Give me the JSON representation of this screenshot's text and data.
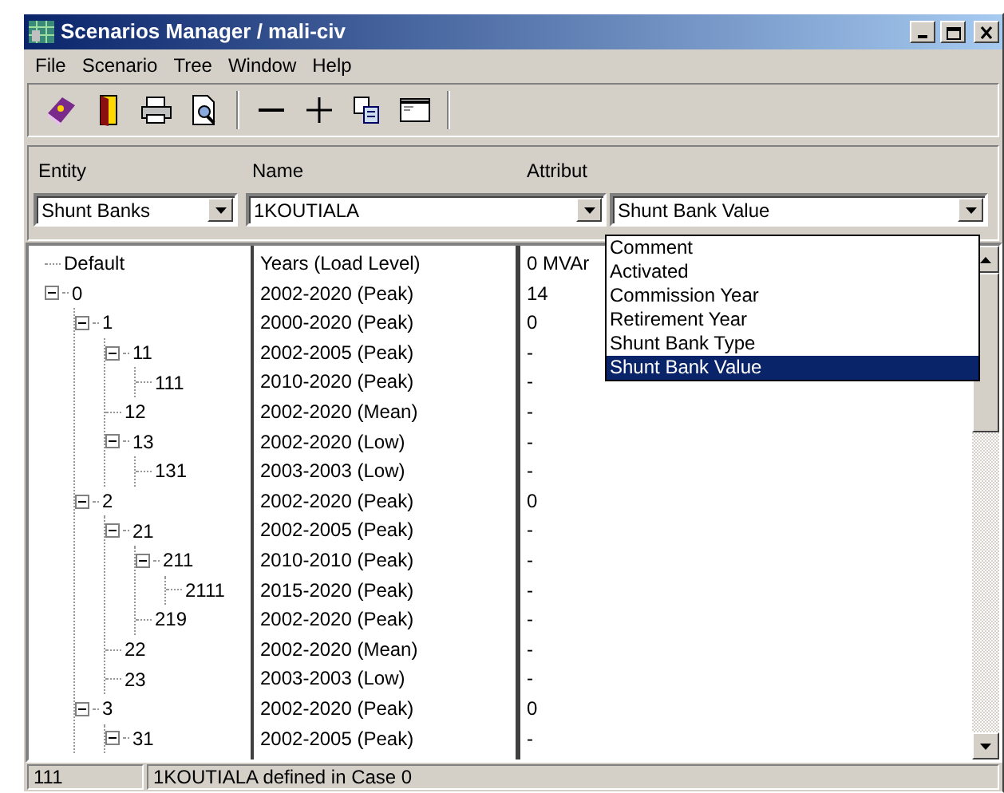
{
  "window": {
    "title": "Scenarios Manager / mali-civ"
  },
  "menu": [
    "File",
    "Scenario",
    "Tree",
    "Window",
    "Help"
  ],
  "filters": {
    "entity": {
      "label": "Entity",
      "value": "Shunt Banks"
    },
    "name": {
      "label": "Name",
      "value": "1KOUTIALA"
    },
    "attribute": {
      "label": "Attribut",
      "value": "Shunt Bank Value",
      "options": [
        {
          "label": "Comment",
          "selected": false
        },
        {
          "label": "Activated",
          "selected": false
        },
        {
          "label": "Commission Year",
          "selected": false
        },
        {
          "label": "Retirement Year",
          "selected": false
        },
        {
          "label": "Shunt Bank Type",
          "selected": false
        },
        {
          "label": "Shunt Bank Value",
          "selected": true
        }
      ]
    }
  },
  "tree": [
    {
      "label": "Default",
      "years": "Years (Load Level)",
      "value": "0 MVAr"
    },
    {
      "label": "0",
      "years": "2002-2020 (Peak)",
      "value": "14",
      "expanded": true,
      "children": [
        {
          "label": "1",
          "years": "2000-2020 (Peak)",
          "value": "0",
          "expanded": true,
          "children": [
            {
              "label": "11",
              "years": "2002-2005 (Peak)",
              "value": "-",
              "expanded": true,
              "children": [
                {
                  "label": "111",
                  "years": "2010-2020 (Peak)",
                  "value": "-"
                }
              ]
            },
            {
              "label": "12",
              "years": "2002-2020 (Mean)",
              "value": "-"
            },
            {
              "label": "13",
              "years": "2002-2020 (Low)",
              "value": "-",
              "expanded": true,
              "children": [
                {
                  "label": "131",
                  "years": "2003-2003 (Low)",
                  "value": "-"
                }
              ]
            }
          ]
        },
        {
          "label": "2",
          "years": "2002-2020 (Peak)",
          "value": "0",
          "expanded": true,
          "children": [
            {
              "label": "21",
              "years": "2002-2005 (Peak)",
              "value": "-",
              "expanded": true,
              "children": [
                {
                  "label": "211",
                  "years": "2010-2010 (Peak)",
                  "value": "-",
                  "expanded": true,
                  "children": [
                    {
                      "label": "2111",
                      "years": "2015-2020 (Peak)",
                      "value": "-"
                    }
                  ]
                },
                {
                  "label": "219",
                  "years": "2002-2020 (Peak)",
                  "value": "-"
                }
              ]
            },
            {
              "label": "22",
              "years": "2002-2020 (Mean)",
              "value": "-"
            },
            {
              "label": "23",
              "years": "2003-2003 (Low)",
              "value": "-"
            }
          ]
        },
        {
          "label": "3",
          "years": "2002-2020 (Peak)",
          "value": "0",
          "expanded": true,
          "children": [
            {
              "label": "31",
              "years": "2002-2005 (Peak)",
              "value": "-",
              "expanded": true
            }
          ]
        }
      ]
    }
  ],
  "status_bar": {
    "code": "111",
    "message": "1KOUTIALA defined in Case 0"
  }
}
